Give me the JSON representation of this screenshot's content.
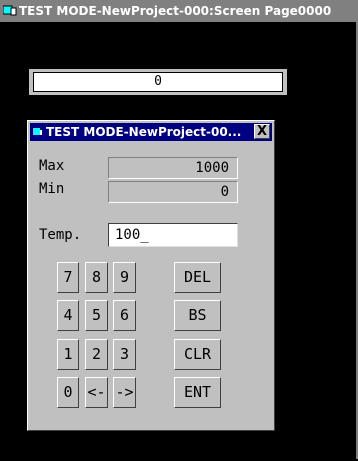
{
  "window": {
    "title": "TEST MODE-NewProject-000:Screen Page0000"
  },
  "screen": {
    "display_value": "0"
  },
  "keypad": {
    "title": "TEST MODE-NewProject-00...",
    "close_label": "X",
    "max_label": "Max",
    "max_value": "1000",
    "min_label": "Min",
    "min_value": "0",
    "temp_label": "Temp.",
    "temp_value": "100_",
    "keys": {
      "k7": "7",
      "k8": "8",
      "k9": "9",
      "del": "DEL",
      "k4": "4",
      "k5": "5",
      "k6": "6",
      "bs": "BS",
      "k1": "1",
      "k2": "2",
      "k3": "3",
      "clr": "CLR",
      "k0": "0",
      "left": "<-",
      "right": "->",
      "ent": "ENT"
    }
  },
  "colors": {
    "title_bar_inactive": "#808080",
    "title_bar_active": "#000080",
    "face": "#c0c0c0",
    "background": "#000000"
  }
}
